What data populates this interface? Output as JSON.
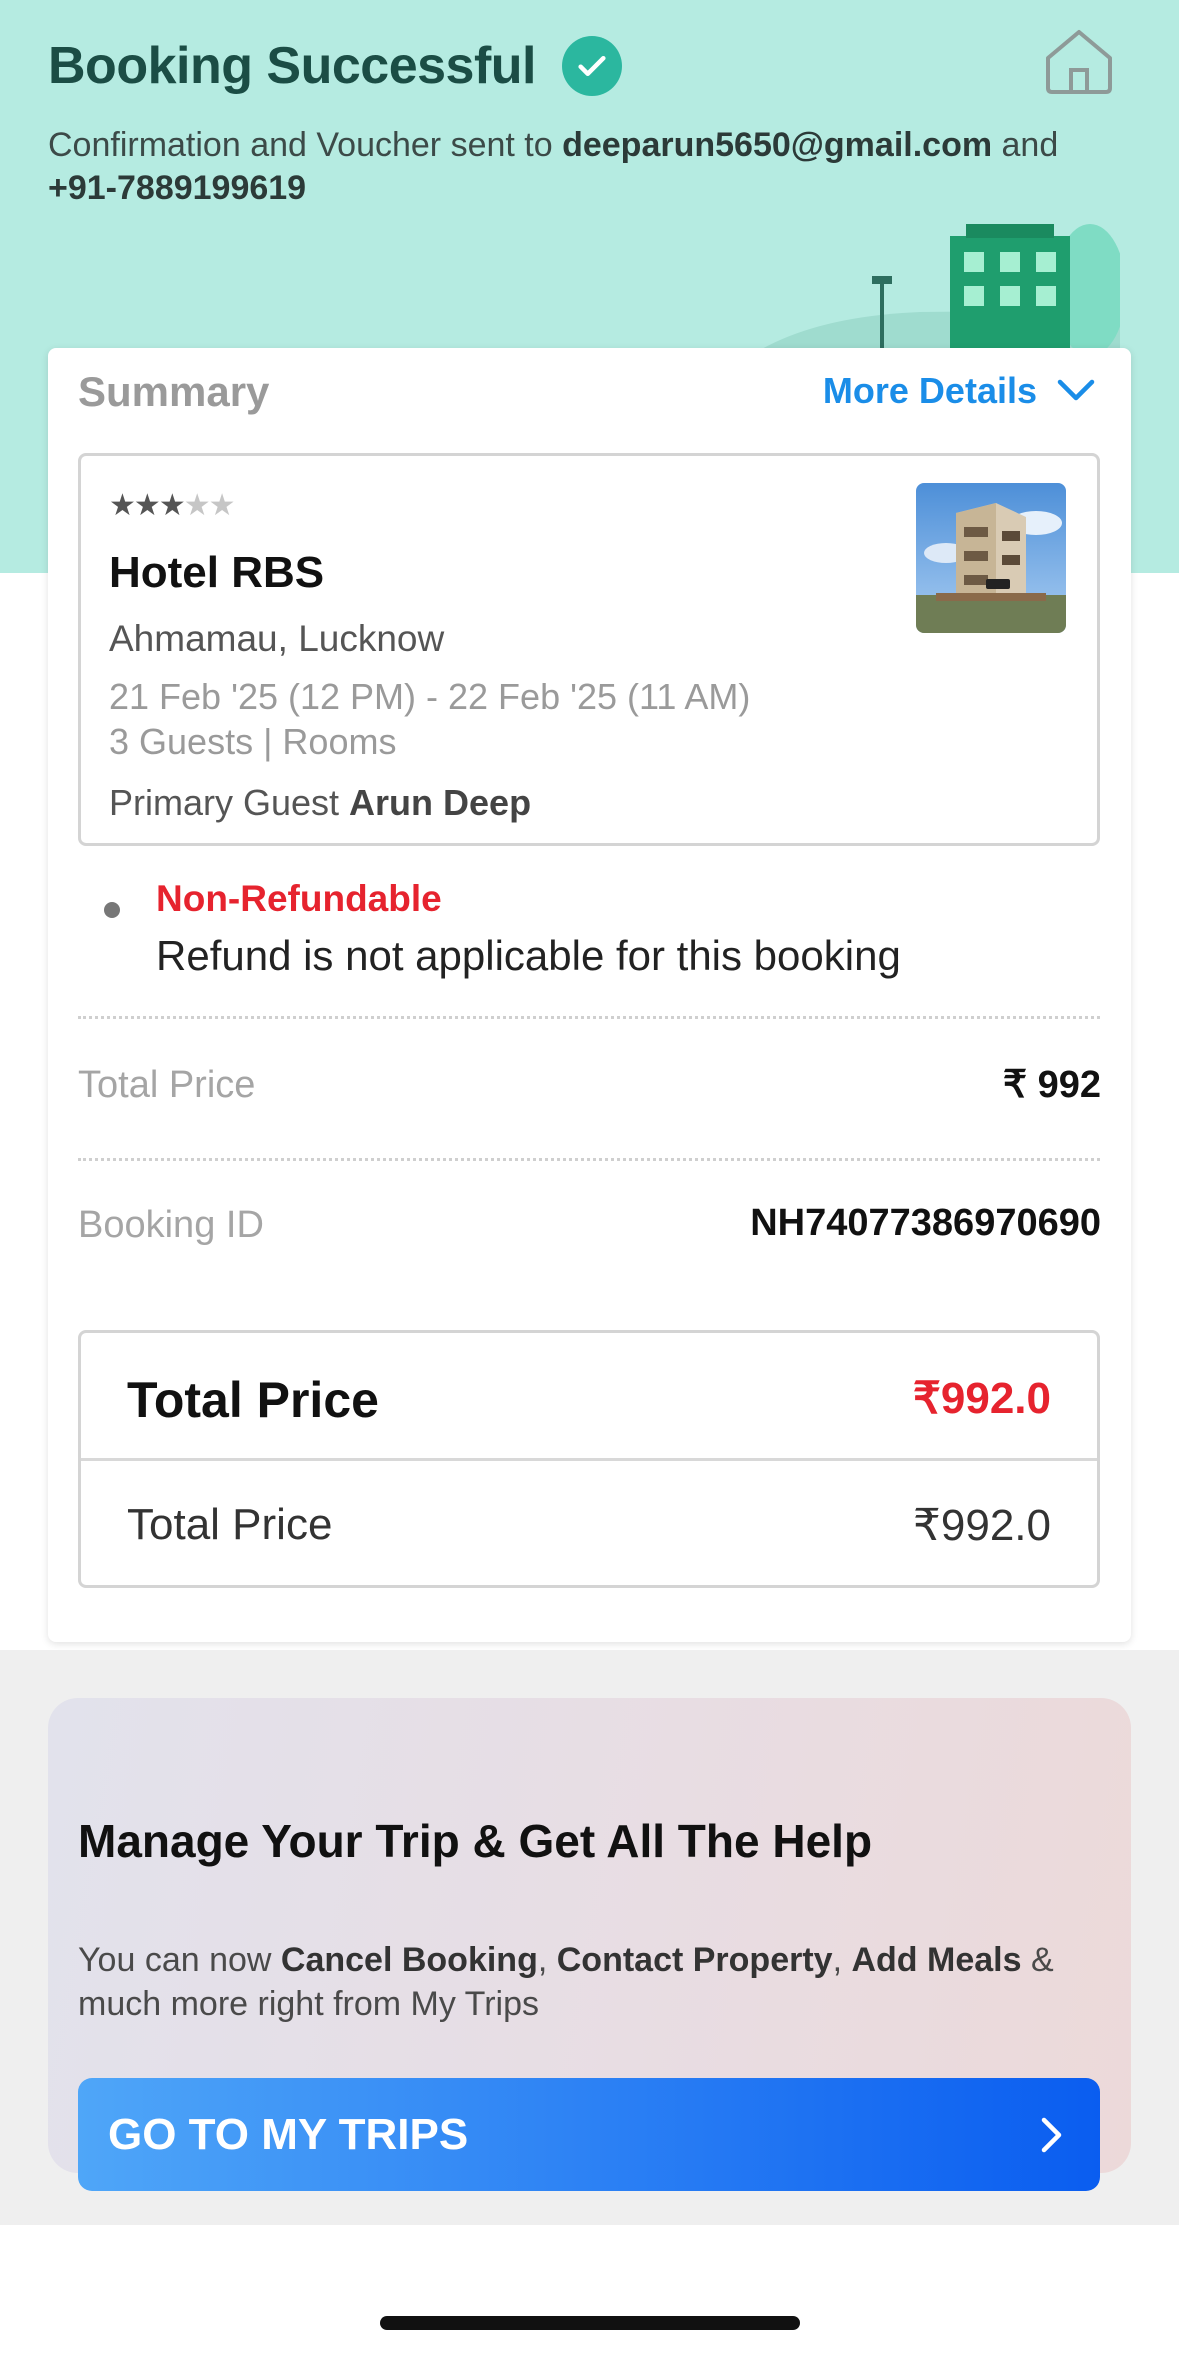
{
  "header": {
    "title": "Booking Successful",
    "subtitle_prefix": "Confirmation and Voucher sent to ",
    "email": "deeparun5650@gmail.com",
    "subtitle_mid": " and",
    "phone": "+91-7889199619"
  },
  "summary": {
    "label": "Summary",
    "more_details": "More Details"
  },
  "hotel": {
    "stars_filled": 3,
    "stars_total": 5,
    "name": "Hotel RBS",
    "location": "Ahmamau, Lucknow",
    "dates": "21 Feb '25 (12 PM) - 22 Feb '25 (11 AM)",
    "guests": "3 Guests |  Rooms",
    "primary_guest_label": "Primary Guest ",
    "primary_guest_name": "Arun Deep"
  },
  "refund": {
    "title": "Non-Refundable",
    "description": "Refund is not applicable for this booking"
  },
  "rows": {
    "total_price_label": "Total Price",
    "total_price_value": "₹ 992",
    "booking_id_label": "Booking ID",
    "booking_id_value": "NH74077386970690"
  },
  "price_box": {
    "title": "Total Price",
    "title_value": "₹992.0",
    "line_label": "Total Price",
    "line_value": "₹992.0"
  },
  "help": {
    "title": "Manage Your Trip & Get All The Help",
    "desc_1": "You can now ",
    "cancel": "Cancel Booking",
    "sep": ", ",
    "contact": "Contact Property",
    "sep2": ", ",
    "meals": "Add Meals",
    "desc_2": " & much more right from My Trips",
    "button": "GO TO MY TRIPS"
  },
  "colors": {
    "hero_bg": "#b5ebe1",
    "accent_blue": "#1a8de8",
    "alert_red": "#e6232e",
    "success_green": "#2bb79f"
  }
}
